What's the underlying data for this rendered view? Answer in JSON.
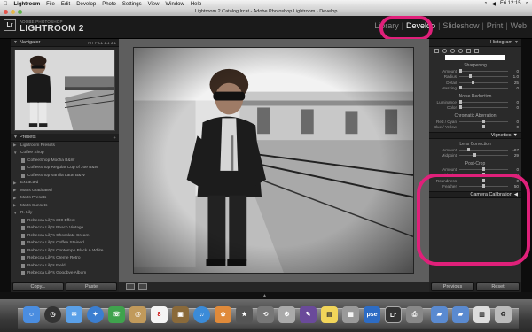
{
  "menubar": {
    "app_name": "Lightroom",
    "items": [
      "File",
      "Edit",
      "Develop",
      "Photo",
      "Settings",
      "View",
      "Window",
      "Help"
    ],
    "clock": "Fri 12:15"
  },
  "window": {
    "title": "Lightroom 2 Catalog.lrcat - Adobe Photoshop Lightroom - Develop"
  },
  "identity": {
    "badge": "Lr",
    "small": "ADOBE PHOTOSHOP",
    "big": "LIGHTROOM 2"
  },
  "modules": [
    {
      "label": "Library"
    },
    {
      "label": "Develop"
    },
    {
      "label": "Slideshow"
    },
    {
      "label": "Print"
    },
    {
      "label": "Web"
    }
  ],
  "navigator": {
    "title": "Navigator",
    "zoom_options": "FIT FILL 1:1 3:1"
  },
  "presets": {
    "title": "Presets",
    "items": [
      "Lightroom Presets",
      "Coffee Shop",
      "CoffeeShop Mocha B&W",
      "CoffeeShop Regular Cup of Joe B&W",
      "CoffeeShop Vanilla Latte B&W",
      "Extracted",
      "Matts Graduated",
      "Matts Presets",
      "Matts Sunsets",
      "R. Lily",
      "Rebecca Lily's 300 Effect",
      "Rebecca Lily's Beach Vintage",
      "Rebecca Lily's Chocolate Cream",
      "Rebecca Lily's Coffee Stained",
      "Rebecca Lily's Contempo Black & White",
      "Rebecca Lily's Creme Retro",
      "Rebecca Lily's Field",
      "Rebecca Lily's Goodbye Album"
    ]
  },
  "left_buttons": {
    "copy": "Copy...",
    "paste": "Paste"
  },
  "histogram": {
    "title": "Histogram"
  },
  "sharpening": {
    "title": "Sharpening",
    "sliders": [
      {
        "label": "Amount",
        "value": "0"
      },
      {
        "label": "Radius",
        "value": "1.0"
      },
      {
        "label": "Detail",
        "value": "25"
      },
      {
        "label": "Masking",
        "value": "0"
      }
    ]
  },
  "noise": {
    "title": "Noise Reduction",
    "sliders": [
      {
        "label": "Luminance",
        "value": "0"
      },
      {
        "label": "Color",
        "value": "0"
      }
    ]
  },
  "chromatic": {
    "title": "Chromatic Aberration",
    "sliders": [
      {
        "label": "Red / Cyan",
        "value": "0"
      },
      {
        "label": "Blue / Yellow",
        "value": "0"
      }
    ]
  },
  "vignettes": {
    "title": "Vignettes",
    "lens_title": "Lens Correction",
    "lens_sliders": [
      {
        "label": "Amount",
        "value": "-67"
      },
      {
        "label": "Midpoint",
        "value": "29"
      }
    ],
    "post_title": "Post-Crop",
    "post_sliders": [
      {
        "label": "Amount",
        "value": "0"
      },
      {
        "label": "Midpoint",
        "value": "50"
      },
      {
        "label": "Roundness",
        "value": "0"
      },
      {
        "label": "Feather",
        "value": "50"
      }
    ]
  },
  "camera_calibration": {
    "title": "Camera Calibration"
  },
  "right_buttons": {
    "previous": "Previous",
    "reset": "Reset"
  },
  "dock": {
    "pse_label": "pse",
    "lr_label": "Lr",
    "calendar_day": "8"
  },
  "colors": {
    "highlight": "#e0207a",
    "panel": "#2a2a2a",
    "workspace": "#5e5e5e"
  }
}
